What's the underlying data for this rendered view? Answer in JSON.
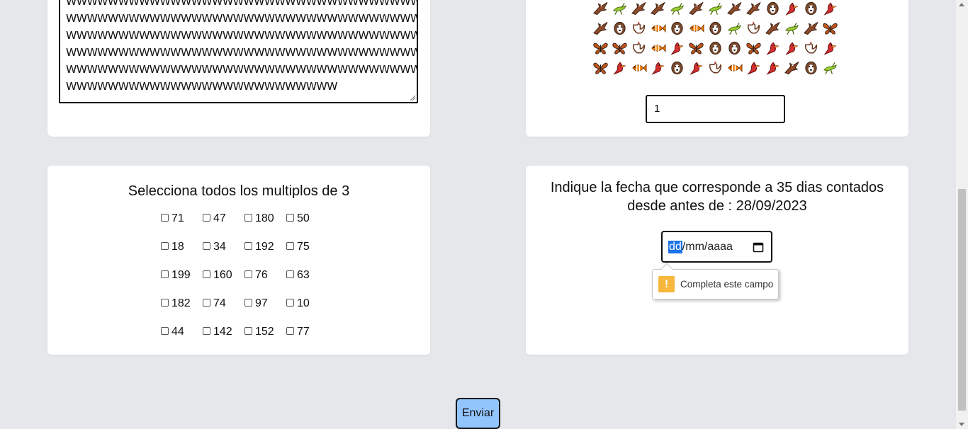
{
  "textarea": {
    "lines": [
      "WWWWWWWWWWWWWWWWWWWWWWWWWWWWWWWWWWWWWWWW",
      "WWWWWWWWWWWWWWWWWWWWWWWWWWWWWWWWWWWWWWWW",
      "WWWWWWWWWWWWWWWWWWWWWWWWWWWWWWWWWWWWWWWW",
      "WWWWWWWWWWWWWWWWWWWWWWWWWWWWWWWWWWWWWWWW",
      "WWWWWWWWWWWWWWWWWWWWWWWWWWWWWWWWWWWWWWWW",
      "WWWWWWWWWWWWWWWWWWWWWWWWWW"
    ]
  },
  "emoji_captcha": {
    "rows": [
      [
        "eagle",
        "grasshopper",
        "eagle",
        "eagle",
        "grasshopper",
        "eagle",
        "grasshopper",
        "eagle",
        "eagle",
        "dog",
        "cardinal",
        "dog",
        "cardinal"
      ],
      [
        "eagle",
        "dog",
        "rooster",
        "fish",
        "dog",
        "fish",
        "dog",
        "grasshopper",
        "rooster",
        "eagle",
        "grasshopper",
        "eagle",
        "butterfly"
      ],
      [
        "butterfly",
        "butterfly",
        "rooster",
        "fish",
        "cardinal",
        "butterfly",
        "dog",
        "dog",
        "butterfly",
        "cardinal",
        "cardinal",
        "rooster",
        "cardinal"
      ],
      [
        "butterfly",
        "cardinal",
        "fish",
        "cardinal",
        "dog",
        "cardinal",
        "rooster",
        "fish",
        "cardinal",
        "cardinal",
        "eagle",
        "dog",
        "grasshopper"
      ]
    ],
    "answer_value": "1",
    "colors": {
      "eagle": "#8b4a2b",
      "grasshopper": "#9acd32",
      "dog": "#7a4a2e",
      "cardinal": "#d32f2f",
      "rooster": "#6b3a22",
      "fish": "#f57c00",
      "butterfly": "#c0561e"
    }
  },
  "multiples": {
    "title": "Selecciona todos los multiplos de 3",
    "rows": [
      [
        "71",
        "47",
        "180",
        "50"
      ],
      [
        "18",
        "34",
        "192",
        "75"
      ],
      [
        "199",
        "160",
        "76",
        "63"
      ],
      [
        "182",
        "74",
        "97",
        "10"
      ],
      [
        "44",
        "142",
        "152",
        "77"
      ]
    ]
  },
  "date_question": {
    "title": "Indique la fecha que corresponde a 35 dias contados desde antes de : 28/09/2023",
    "placeholder_day": "dd",
    "placeholder_rest": "/mm/aaaa",
    "validation_message": "Completa este campo"
  },
  "submit": {
    "label": "Enviar"
  }
}
